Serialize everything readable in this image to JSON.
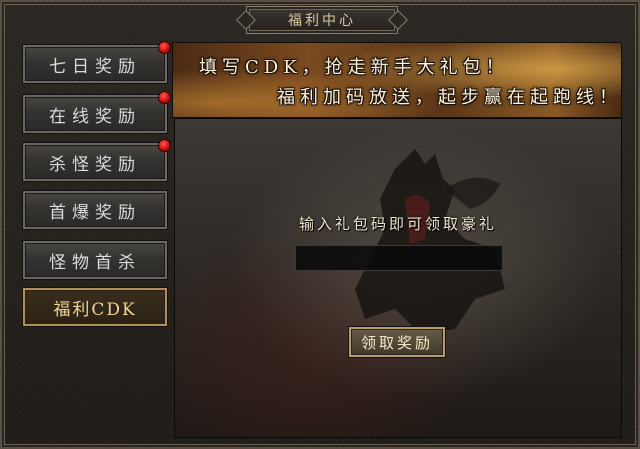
{
  "window": {
    "title": "福利中心"
  },
  "sidebar": {
    "items": [
      {
        "label": "七日奖励",
        "has_notice": true
      },
      {
        "label": "在线奖励",
        "has_notice": true
      },
      {
        "label": "杀怪奖励",
        "has_notice": true
      },
      {
        "label": "首爆奖励",
        "has_notice": false
      },
      {
        "label": "怪物首杀",
        "has_notice": false
      },
      {
        "label": "福利CDK",
        "has_notice": false,
        "selected": true
      }
    ]
  },
  "banner": {
    "line1": "填写CDK，抢走新手大礼包！",
    "line2": "福利加码放送，起步赢在起跑线！"
  },
  "main": {
    "prompt": "输入礼包码即可领取豪礼",
    "cdk_input": {
      "value": "",
      "placeholder": ""
    },
    "claim_button": "领取奖励"
  },
  "icons": {
    "notice": "red-dot-icon"
  },
  "colors": {
    "notice": "#c20c0c",
    "accent": "#b09058"
  }
}
